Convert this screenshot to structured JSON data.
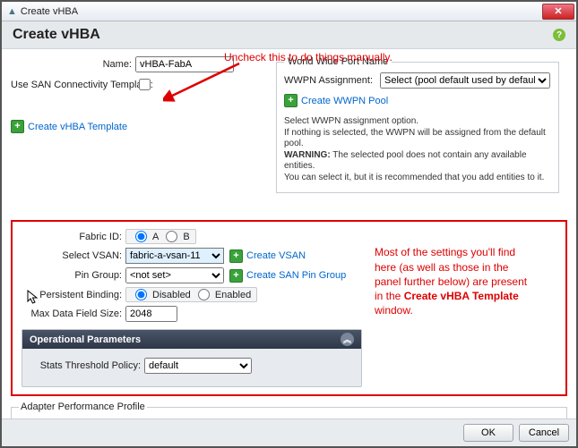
{
  "window": {
    "title": "Create vHBA"
  },
  "header": {
    "title": "Create vHBA"
  },
  "annotations": {
    "top": "Uncheck this to do things manually.",
    "mid_lines": [
      "Most of the settings you'll find",
      "here (as well as those in the",
      "panel further below) are present",
      "in the ",
      "Create vHBA Template",
      "window."
    ]
  },
  "top_form": {
    "name_label": "Name:",
    "name_value": "vHBA-FabA",
    "use_template_label": "Use SAN Connectivity Template:",
    "create_vhba_template": "Create vHBA Template"
  },
  "wwpn": {
    "legend": "World Wide Port Name",
    "assign_label": "WWPN Assignment:",
    "assign_value": "Select (pool default used by default)",
    "create_pool": "Create WWPN Pool",
    "hint1": "Select WWPN assignment option.",
    "hint2": "If nothing is selected, the WWPN will be assigned from the default pool.",
    "hint3a": "WARNING:",
    "hint3b": " The selected pool does not contain any available entities.",
    "hint4": "You can select it, but it is recommended that you add entities to it."
  },
  "mid": {
    "fabric_label": "Fabric ID:",
    "fabric_a": "A",
    "fabric_b": "B",
    "vsan_label": "Select VSAN:",
    "vsan_value": "fabric-a-vsan-11",
    "create_vsan": "Create VSAN",
    "pin_label": "Pin Group:",
    "pin_value": "<not set>",
    "create_pin": "Create SAN Pin Group",
    "pb_label": "Persistent Binding:",
    "pb_disabled": "Disabled",
    "pb_enabled": "Enabled",
    "mdf_label": "Max Data Field Size:",
    "mdf_value": "2048"
  },
  "op": {
    "title": "Operational Parameters",
    "stats_label": "Stats Threshold Policy:",
    "stats_value": "default"
  },
  "adapter": {
    "legend": "Adapter Performance Profile"
  },
  "footer": {
    "ok": "OK",
    "cancel": "Cancel"
  }
}
